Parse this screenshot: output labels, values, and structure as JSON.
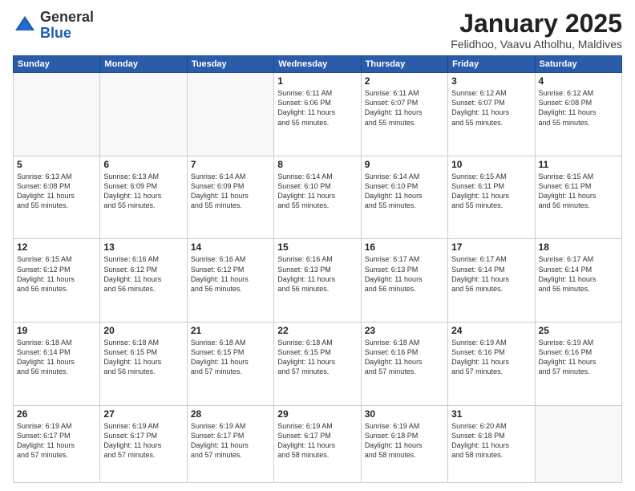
{
  "logo": {
    "general": "General",
    "blue": "Blue"
  },
  "header": {
    "title": "January 2025",
    "location": "Felidhoo, Vaavu Atholhu, Maldives"
  },
  "weekdays": [
    "Sunday",
    "Monday",
    "Tuesday",
    "Wednesday",
    "Thursday",
    "Friday",
    "Saturday"
  ],
  "weeks": [
    [
      {
        "day": "",
        "info": ""
      },
      {
        "day": "",
        "info": ""
      },
      {
        "day": "",
        "info": ""
      },
      {
        "day": "1",
        "info": "Sunrise: 6:11 AM\nSunset: 6:06 PM\nDaylight: 11 hours\nand 55 minutes."
      },
      {
        "day": "2",
        "info": "Sunrise: 6:11 AM\nSunset: 6:07 PM\nDaylight: 11 hours\nand 55 minutes."
      },
      {
        "day": "3",
        "info": "Sunrise: 6:12 AM\nSunset: 6:07 PM\nDaylight: 11 hours\nand 55 minutes."
      },
      {
        "day": "4",
        "info": "Sunrise: 6:12 AM\nSunset: 6:08 PM\nDaylight: 11 hours\nand 55 minutes."
      }
    ],
    [
      {
        "day": "5",
        "info": "Sunrise: 6:13 AM\nSunset: 6:08 PM\nDaylight: 11 hours\nand 55 minutes."
      },
      {
        "day": "6",
        "info": "Sunrise: 6:13 AM\nSunset: 6:09 PM\nDaylight: 11 hours\nand 55 minutes."
      },
      {
        "day": "7",
        "info": "Sunrise: 6:14 AM\nSunset: 6:09 PM\nDaylight: 11 hours\nand 55 minutes."
      },
      {
        "day": "8",
        "info": "Sunrise: 6:14 AM\nSunset: 6:10 PM\nDaylight: 11 hours\nand 55 minutes."
      },
      {
        "day": "9",
        "info": "Sunrise: 6:14 AM\nSunset: 6:10 PM\nDaylight: 11 hours\nand 55 minutes."
      },
      {
        "day": "10",
        "info": "Sunrise: 6:15 AM\nSunset: 6:11 PM\nDaylight: 11 hours\nand 55 minutes."
      },
      {
        "day": "11",
        "info": "Sunrise: 6:15 AM\nSunset: 6:11 PM\nDaylight: 11 hours\nand 56 minutes."
      }
    ],
    [
      {
        "day": "12",
        "info": "Sunrise: 6:15 AM\nSunset: 6:12 PM\nDaylight: 11 hours\nand 56 minutes."
      },
      {
        "day": "13",
        "info": "Sunrise: 6:16 AM\nSunset: 6:12 PM\nDaylight: 11 hours\nand 56 minutes."
      },
      {
        "day": "14",
        "info": "Sunrise: 6:16 AM\nSunset: 6:12 PM\nDaylight: 11 hours\nand 56 minutes."
      },
      {
        "day": "15",
        "info": "Sunrise: 6:16 AM\nSunset: 6:13 PM\nDaylight: 11 hours\nand 56 minutes."
      },
      {
        "day": "16",
        "info": "Sunrise: 6:17 AM\nSunset: 6:13 PM\nDaylight: 11 hours\nand 56 minutes."
      },
      {
        "day": "17",
        "info": "Sunrise: 6:17 AM\nSunset: 6:14 PM\nDaylight: 11 hours\nand 56 minutes."
      },
      {
        "day": "18",
        "info": "Sunrise: 6:17 AM\nSunset: 6:14 PM\nDaylight: 11 hours\nand 56 minutes."
      }
    ],
    [
      {
        "day": "19",
        "info": "Sunrise: 6:18 AM\nSunset: 6:14 PM\nDaylight: 11 hours\nand 56 minutes."
      },
      {
        "day": "20",
        "info": "Sunrise: 6:18 AM\nSunset: 6:15 PM\nDaylight: 11 hours\nand 56 minutes."
      },
      {
        "day": "21",
        "info": "Sunrise: 6:18 AM\nSunset: 6:15 PM\nDaylight: 11 hours\nand 57 minutes."
      },
      {
        "day": "22",
        "info": "Sunrise: 6:18 AM\nSunset: 6:15 PM\nDaylight: 11 hours\nand 57 minutes."
      },
      {
        "day": "23",
        "info": "Sunrise: 6:18 AM\nSunset: 6:16 PM\nDaylight: 11 hours\nand 57 minutes."
      },
      {
        "day": "24",
        "info": "Sunrise: 6:19 AM\nSunset: 6:16 PM\nDaylight: 11 hours\nand 57 minutes."
      },
      {
        "day": "25",
        "info": "Sunrise: 6:19 AM\nSunset: 6:16 PM\nDaylight: 11 hours\nand 57 minutes."
      }
    ],
    [
      {
        "day": "26",
        "info": "Sunrise: 6:19 AM\nSunset: 6:17 PM\nDaylight: 11 hours\nand 57 minutes."
      },
      {
        "day": "27",
        "info": "Sunrise: 6:19 AM\nSunset: 6:17 PM\nDaylight: 11 hours\nand 57 minutes."
      },
      {
        "day": "28",
        "info": "Sunrise: 6:19 AM\nSunset: 6:17 PM\nDaylight: 11 hours\nand 57 minutes."
      },
      {
        "day": "29",
        "info": "Sunrise: 6:19 AM\nSunset: 6:17 PM\nDaylight: 11 hours\nand 58 minutes."
      },
      {
        "day": "30",
        "info": "Sunrise: 6:19 AM\nSunset: 6:18 PM\nDaylight: 11 hours\nand 58 minutes."
      },
      {
        "day": "31",
        "info": "Sunrise: 6:20 AM\nSunset: 6:18 PM\nDaylight: 11 hours\nand 58 minutes."
      },
      {
        "day": "",
        "info": ""
      }
    ]
  ]
}
